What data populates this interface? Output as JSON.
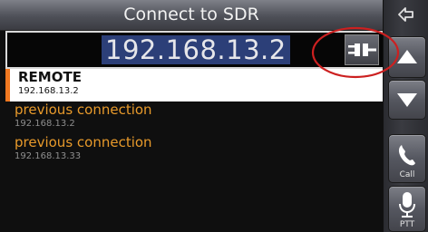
{
  "header": {
    "title": "Connect to SDR"
  },
  "address": {
    "value": "192.168.13.2"
  },
  "connections": [
    {
      "title": "REMOTE",
      "address": "192.168.13.2",
      "selected": true
    },
    {
      "title": "previous connection",
      "address": "192.168.13.2",
      "selected": false
    },
    {
      "title": "previous connection",
      "address": "192.168.13.33",
      "selected": false
    }
  ],
  "sidebar": {
    "back_icon": "back-arrow-icon",
    "up_icon": "triangle-up-icon",
    "down_icon": "triangle-down-icon",
    "call_label": "Call",
    "ptt_label": "PTT"
  },
  "colors": {
    "accent": "#f07820",
    "item_title": "#e89a2b",
    "address_highlight": "#2c3f78",
    "annotation": "#cc2020"
  }
}
